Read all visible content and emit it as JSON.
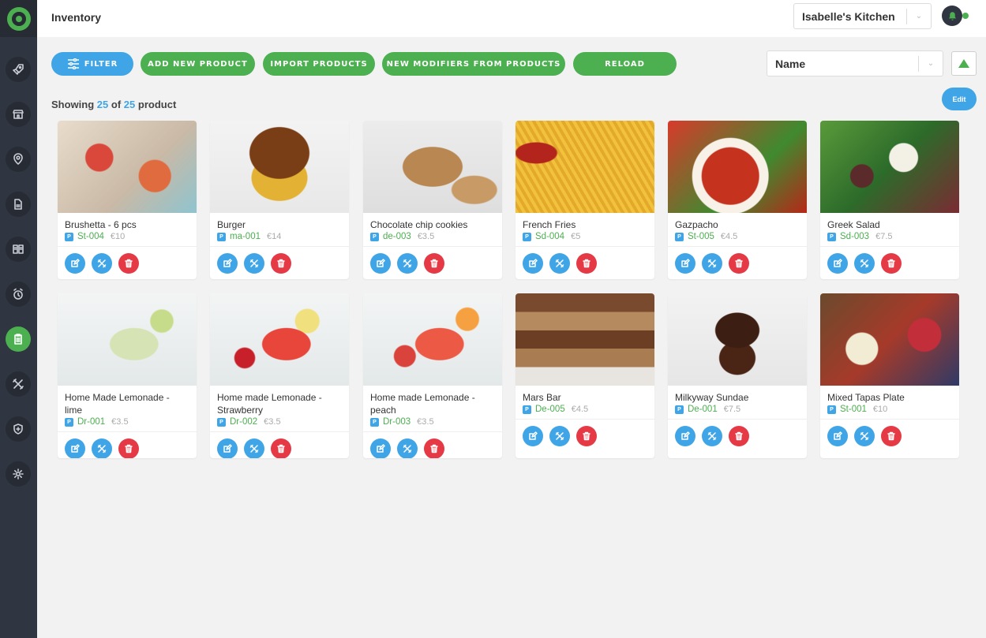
{
  "app": {
    "page_title": "Inventory",
    "kitchen_select": "Isabelle's Kitchen",
    "colors": {
      "primary_blue": "#3fa5e6",
      "primary_green": "#4caf50",
      "danger_red": "#e53945",
      "sidebar": "#2f3541"
    }
  },
  "sidebar": {
    "items": [
      {
        "icon": "rocket-icon"
      },
      {
        "icon": "store-icon"
      },
      {
        "icon": "location-pin-icon"
      },
      {
        "icon": "document-icon"
      },
      {
        "icon": "menu-book-icon"
      },
      {
        "icon": "alarm-clock-icon"
      },
      {
        "icon": "clipboard-icon",
        "active": true
      },
      {
        "icon": "utensils-icon"
      },
      {
        "icon": "shield-plus-icon"
      },
      {
        "icon": "gear-icon"
      }
    ]
  },
  "toolbar": {
    "filter_label": "FILTER",
    "add_label": "ADD NEW PRODUCT",
    "import_label": "IMPORT PRODUCTS",
    "modifiers_label": "NEW MODIFIERS FROM PRODUCTS",
    "reload_label": "RELOAD",
    "sort_select": "Name",
    "sort_direction": "ascending",
    "edit_label": "Edit"
  },
  "summary": {
    "prefix": "Showing",
    "shown": "25",
    "of": "of",
    "total": "25",
    "suffix": "product"
  },
  "products": [
    {
      "name": "Brushetta - 6 pcs",
      "badge": "P",
      "sku": "St-004",
      "price": "€10"
    },
    {
      "name": "Burger",
      "badge": "P",
      "sku": "ma-001",
      "price": "€14"
    },
    {
      "name": "Chocolate chip cookies",
      "badge": "P",
      "sku": "de-003",
      "price": "€3.5"
    },
    {
      "name": "French Fries",
      "badge": "P",
      "sku": "Sd-004",
      "price": "€5"
    },
    {
      "name": "Gazpacho",
      "badge": "P",
      "sku": "St-005",
      "price": "€4.5"
    },
    {
      "name": "Greek Salad",
      "badge": "P",
      "sku": "Sd-003",
      "price": "€7.5"
    },
    {
      "name": "Home Made Lemonade - lime",
      "badge": "P",
      "sku": "Dr-001",
      "price": "€3.5"
    },
    {
      "name": "Home made Lemonade - Strawberry",
      "badge": "P",
      "sku": "Dr-002",
      "price": "€3.5"
    },
    {
      "name": "Home made Lemonade - peach",
      "badge": "P",
      "sku": "Dr-003",
      "price": "€3.5"
    },
    {
      "name": "Mars Bar",
      "badge": "P",
      "sku": "De-005",
      "price": "€4.5"
    },
    {
      "name": "Milkyway Sundae",
      "badge": "P",
      "sku": "De-001",
      "price": "€7.5"
    },
    {
      "name": "Mixed Tapas Plate",
      "badge": "P",
      "sku": "St-001",
      "price": "€10"
    }
  ]
}
